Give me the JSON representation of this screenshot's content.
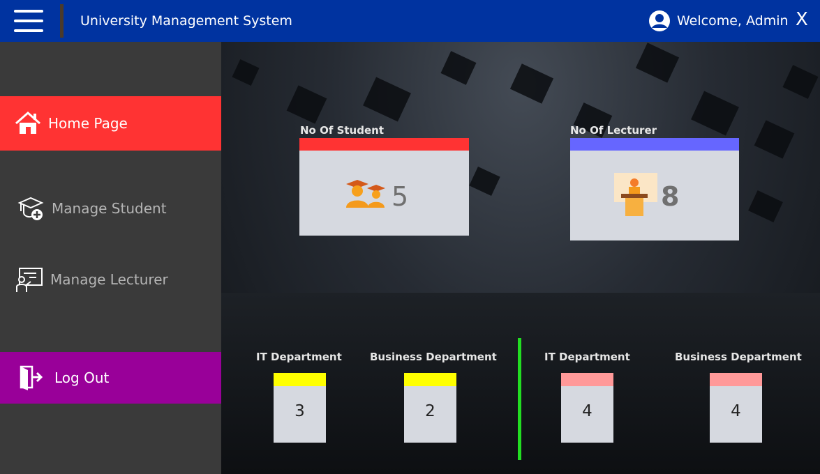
{
  "header": {
    "menu_icon": "hamburger-menu-icon",
    "title": "University Management System",
    "user_icon": "user-avatar-icon",
    "welcome": "Welcome, Admin",
    "close_label": "X"
  },
  "sidebar": {
    "items": [
      {
        "label": "Home Page",
        "icon": "home-icon",
        "active": true
      },
      {
        "label": "Manage Student",
        "icon": "student-cap-add-icon"
      },
      {
        "label": "Manage Lecturer",
        "icon": "lecturer-board-icon"
      },
      {
        "label": "Log Out",
        "icon": "logout-door-icon"
      }
    ]
  },
  "stats": {
    "students": {
      "label": "No Of Student",
      "value": "5",
      "icon": "graduates-icon",
      "color": "#ff3333"
    },
    "lecturers": {
      "label": "No Of Lecturer",
      "value": "8",
      "icon": "lecturer-podium-icon",
      "color": "#6666ff"
    }
  },
  "departments": {
    "students": [
      {
        "name": "IT Department",
        "count": "3",
        "color": "#ffff00"
      },
      {
        "name": "Business Department",
        "count": "2",
        "color": "#ffff00"
      }
    ],
    "lecturers": [
      {
        "name": "IT Department",
        "count": "4",
        "color": "#ff9999"
      },
      {
        "name": "Business Department",
        "count": "4",
        "color": "#ff9999"
      }
    ]
  },
  "colors": {
    "topbar": "#0033a0",
    "sidebar": "#3a3a3a",
    "active_nav": "#ff3333",
    "logout": "#990099",
    "separator": "#22dd22"
  }
}
